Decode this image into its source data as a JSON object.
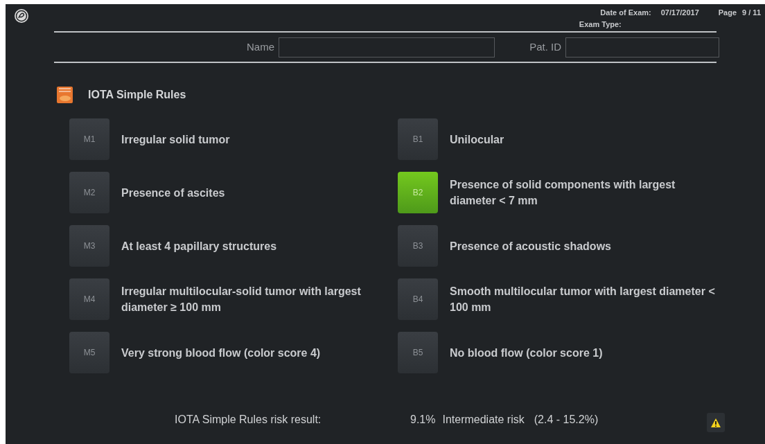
{
  "header": {
    "date_label": "Date of Exam:",
    "date_value": "07/17/2017",
    "page_label": "Page",
    "page_value": "9 / 11",
    "exam_type_label": "Exam Type:"
  },
  "patient": {
    "name_label": "Name",
    "id_label": "Pat. ID"
  },
  "title": "IOTA Simple Rules",
  "malignant_rules": [
    {
      "code": "M1",
      "text": "Irregular solid tumor",
      "selected": false
    },
    {
      "code": "M2",
      "text": "Presence of ascites",
      "selected": false
    },
    {
      "code": "M3",
      "text": "At least 4 papillary structures",
      "selected": false
    },
    {
      "code": "M4",
      "text": "Irregular multilocular-solid tumor with largest diameter ≥ 100 mm",
      "selected": false
    },
    {
      "code": "M5",
      "text": "Very strong blood flow (color score 4)",
      "selected": false
    }
  ],
  "benign_rules": [
    {
      "code": "B1",
      "text": "Unilocular",
      "selected": false
    },
    {
      "code": "B2",
      "text": "Presence of solid components with largest diameter < 7 mm",
      "selected": true
    },
    {
      "code": "B3",
      "text": "Presence of acoustic shadows",
      "selected": false
    },
    {
      "code": "B4",
      "text": "Smooth multilocular tumor with largest diameter < 100 mm",
      "selected": false
    },
    {
      "code": "B5",
      "text": "No blood flow (color score 1)",
      "selected": false
    }
  ],
  "result": {
    "label": "IOTA Simple Rules risk result:",
    "percent": "9.1%",
    "category": "Intermediate risk",
    "range": "(2.4 - 15.2%)"
  }
}
